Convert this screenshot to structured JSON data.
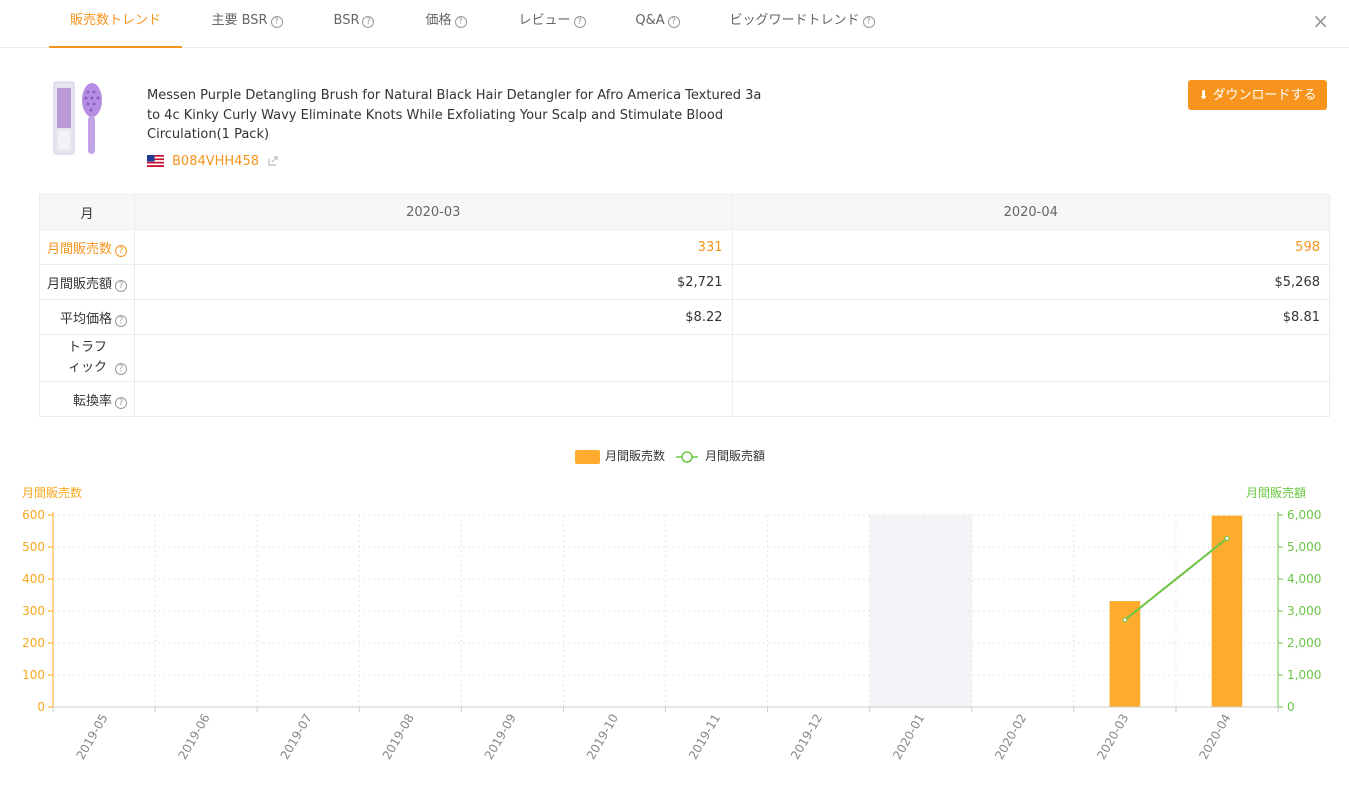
{
  "tabs": [
    {
      "label": "販売数トレンド",
      "help": false,
      "active": true
    },
    {
      "label": "主要 BSR",
      "help": true,
      "active": false
    },
    {
      "label": "BSR",
      "help": true,
      "active": false
    },
    {
      "label": "価格",
      "help": true,
      "active": false
    },
    {
      "label": "レビュー",
      "help": true,
      "active": false
    },
    {
      "label": "Q&A",
      "help": true,
      "active": false
    },
    {
      "label": "ビッグワードトレンド",
      "help": true,
      "active": false
    }
  ],
  "close_icon": "×",
  "product": {
    "title": "Messen Purple Detangling Brush for Natural Black Hair Detangler for Afro America Textured 3a to 4c Kinky Curly Wavy Eliminate Knots While Exfoliating Your Scalp and Stimulate Blood Circulation(1 Pack)",
    "asin": "B084VHH458",
    "marketplace_flag": "us-flag-icon"
  },
  "download_label": "ダウンロードする",
  "table": {
    "header_label": "月",
    "months": [
      "2020-03",
      "2020-04"
    ],
    "rows": [
      {
        "label": "月間販売数",
        "values": [
          "331",
          "598"
        ],
        "highlight": true
      },
      {
        "label": "月間販売額",
        "values": [
          "$2,721",
          "$5,268"
        ],
        "highlight": false
      },
      {
        "label": "平均価格",
        "values": [
          "$8.22",
          "$8.81"
        ],
        "highlight": false
      },
      {
        "label": "トラフィック",
        "values": [
          "",
          ""
        ],
        "highlight": false
      },
      {
        "label": "転換率",
        "values": [
          "",
          ""
        ],
        "highlight": false
      }
    ]
  },
  "chart_data": {
    "type": "bar",
    "legend": [
      {
        "name": "月間販売数",
        "color": "#ffab2e"
      },
      {
        "name": "月間販売額",
        "color": "#6cc644"
      }
    ],
    "categories": [
      "2019-05",
      "2019-06",
      "2019-07",
      "2019-08",
      "2019-09",
      "2019-10",
      "2019-11",
      "2019-12",
      "2020-01",
      "2020-02",
      "2020-03",
      "2020-04"
    ],
    "series": [
      {
        "name": "月間販売数",
        "type": "bar",
        "axis": "left",
        "color": "#ffab2e",
        "values": [
          null,
          null,
          null,
          null,
          null,
          null,
          null,
          null,
          null,
          null,
          331,
          598
        ]
      },
      {
        "name": "月間販売額",
        "type": "line",
        "axis": "right",
        "color": "#6cc644",
        "values": [
          null,
          null,
          null,
          null,
          null,
          null,
          null,
          null,
          null,
          null,
          2721,
          5268
        ]
      }
    ],
    "ylabel_left": "月間販売数",
    "ylabel_right": "月間販売額",
    "ylim_left": [
      0,
      600
    ],
    "yticks_left": [
      "0",
      "100",
      "200",
      "300",
      "400",
      "500",
      "600"
    ],
    "ylim_right": [
      0,
      6000
    ],
    "yticks_right": [
      "0",
      "1,000",
      "2,000",
      "3,000",
      "4,000",
      "5,000",
      "6,000"
    ],
    "highlighted_category": "2020-01",
    "grid": true,
    "legend_position": "top-center",
    "left_axis_color": "#f7a81b",
    "right_axis_color": "#6cc644"
  }
}
